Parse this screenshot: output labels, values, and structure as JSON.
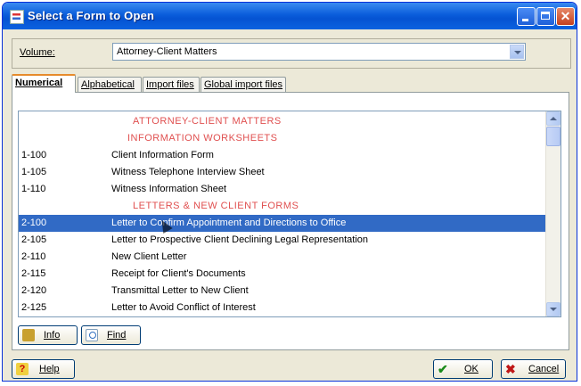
{
  "window": {
    "title": "Select a Form to Open"
  },
  "volume": {
    "label": "Volume:",
    "value": "Attorney-Client Matters"
  },
  "tabs": [
    {
      "label": "Numerical",
      "active": true
    },
    {
      "label": "Alphabetical",
      "active": false
    },
    {
      "label": "Import files",
      "active": false
    },
    {
      "label": "Global import files",
      "active": false
    }
  ],
  "list": {
    "rows": [
      {
        "code": "",
        "title": "ATTORNEY-CLIENT MATTERS",
        "header": true
      },
      {
        "code": "",
        "title": "INFORMATION WORKSHEETS",
        "header": true
      },
      {
        "code": "1-100",
        "title": "Client Information Form"
      },
      {
        "code": "1-105",
        "title": "Witness Telephone Interview Sheet"
      },
      {
        "code": "1-110",
        "title": "Witness Information Sheet"
      },
      {
        "code": "",
        "title": "LETTERS & NEW CLIENT FORMS",
        "header": true
      },
      {
        "code": "2-100",
        "title": "Letter to Confirm Appointment and Directions to Office",
        "selected": true
      },
      {
        "code": "2-105",
        "title": "Letter to Prospective Client Declining Legal Representation"
      },
      {
        "code": "2-110",
        "title": "New Client Letter"
      },
      {
        "code": "2-115",
        "title": "Receipt for Client's Documents"
      },
      {
        "code": "2-120",
        "title": "Transmittal Letter to New Client"
      },
      {
        "code": "2-125",
        "title": "Letter to Avoid Conflict of Interest"
      }
    ]
  },
  "buttons": {
    "info": "Info",
    "find": "Find",
    "help": "Help",
    "ok": "OK",
    "cancel": "Cancel"
  },
  "icons": {
    "info": "info-icon",
    "find": "find-icon",
    "help": "help-icon",
    "ok": "check-icon",
    "cancel": "x-icon"
  },
  "colors": {
    "titlebar": "#0553d2",
    "selection": "#316ac5",
    "header_text": "#e05050"
  }
}
